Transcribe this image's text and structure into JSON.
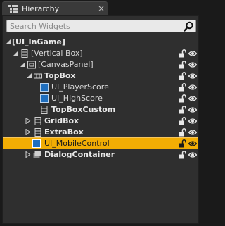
{
  "tab": {
    "title": "Hierarchy",
    "icon": "hierarchy-icon",
    "close": "×"
  },
  "search": {
    "placeholder": "Search Widgets",
    "value": ""
  },
  "tree": [
    {
      "label": "[UI_InGame]",
      "bold": true,
      "icon": "none",
      "arrow": "expanded",
      "lock": false,
      "eye": false
    },
    {
      "label": "[Vertical Box]",
      "bold": false,
      "icon": "vertical-box-icon",
      "arrow": "expanded",
      "lock": true,
      "eye": true
    },
    {
      "label": "[CanvasPanel]",
      "bold": false,
      "icon": "canvas-panel-icon",
      "arrow": "expanded",
      "lock": true,
      "eye": true
    },
    {
      "label": "TopBox",
      "bold": true,
      "icon": "horizontal-box-icon",
      "arrow": "expanded",
      "lock": true,
      "eye": true
    },
    {
      "label": "UI_PlayerScore",
      "bold": false,
      "icon": "user-widget-icon",
      "arrow": "none",
      "lock": true,
      "eye": true
    },
    {
      "label": "UI_HighScore",
      "bold": false,
      "icon": "user-widget-icon",
      "arrow": "none",
      "lock": true,
      "eye": true
    },
    {
      "label": "TopBoxCustom",
      "bold": true,
      "icon": "vertical-box-icon",
      "arrow": "none",
      "lock": true,
      "eye": true
    },
    {
      "label": "GridBox",
      "bold": true,
      "icon": "vertical-box-icon",
      "arrow": "collapsed",
      "lock": true,
      "eye": true
    },
    {
      "label": "ExtraBox",
      "bold": true,
      "icon": "vertical-box-icon",
      "arrow": "collapsed",
      "lock": true,
      "eye": true
    },
    {
      "label": "UI_MobileControl",
      "bold": false,
      "icon": "user-widget-icon",
      "arrow": "none",
      "lock": true,
      "eye": true,
      "selected": true
    },
    {
      "label": "DialogContainer",
      "bold": true,
      "icon": "overlay-icon",
      "arrow": "collapsed",
      "lock": true,
      "eye": true
    }
  ],
  "colors": {
    "selected": "#f2ad04",
    "panel": "#2f2f2f",
    "background": "#1a1a1a",
    "user_widget": "#1f6fbf"
  }
}
